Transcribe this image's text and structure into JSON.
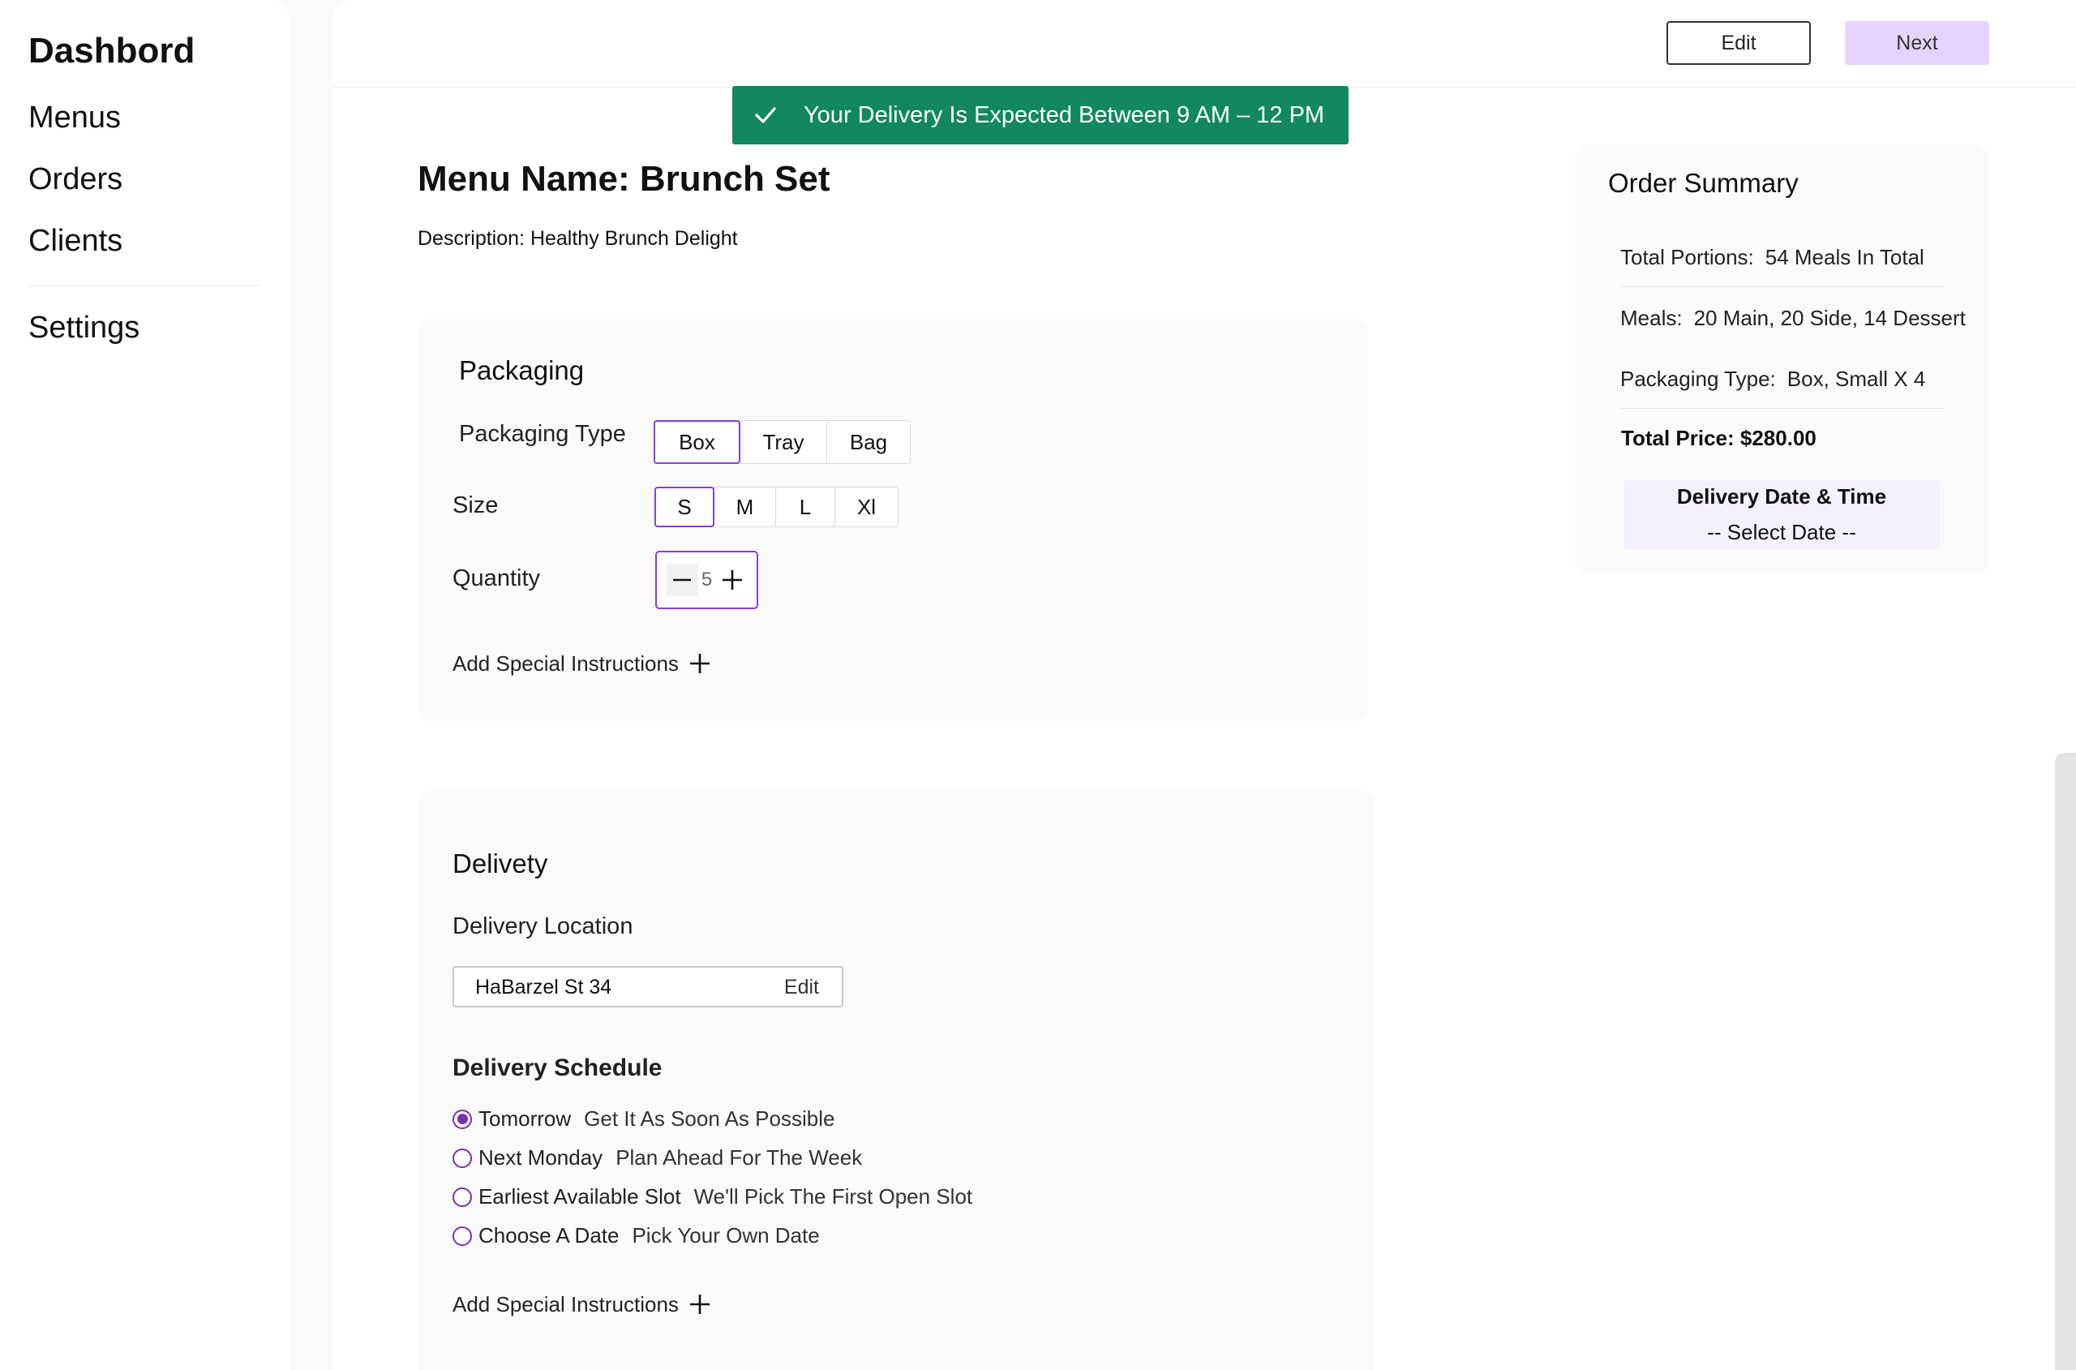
{
  "sidebar": {
    "title": "Dashbord",
    "items": [
      {
        "label": "Menus"
      },
      {
        "label": "Orders"
      },
      {
        "label": "Clients"
      },
      {
        "label": "Settings"
      }
    ]
  },
  "toolbar": {
    "edit_label": "Edit",
    "next_label": "Next"
  },
  "toast": {
    "message": "Your Delivery Is Expected Between 9 AM – 12 PM",
    "icon": "check-icon",
    "color": "#12885f"
  },
  "menu": {
    "name": "Menu  Name: Brunch Set",
    "description": "Description: Healthy Brunch Delight"
  },
  "packaging": {
    "heading": "Packaging",
    "type_label": "Packaging Type",
    "types": [
      "Box",
      "Tray",
      "Bag"
    ],
    "selected_type": "Box",
    "size_label": "Size",
    "sizes": [
      "S",
      "M",
      "L",
      "Xl"
    ],
    "selected_size": "S",
    "quantity_label": "Quantity",
    "quantity": "5",
    "add_instructions": "Add Special Instructions"
  },
  "delivery": {
    "heading": "Delivety",
    "location_label": "Delivery Location",
    "address": "HaBarzel St 34",
    "address_edit": "Edit",
    "schedule_label": "Delivery Schedule",
    "options": [
      {
        "label": "Tomorrow",
        "sub": "Get It As Soon As Possible",
        "checked": true
      },
      {
        "label": "Next Monday",
        "sub": "Plan Ahead For The Week",
        "checked": false
      },
      {
        "label": "Earliest Available Slot",
        "sub": "We'll Pick The First Open Slot",
        "checked": false
      },
      {
        "label": "Choose A Date",
        "sub": "Pick Your Own Date",
        "checked": false
      }
    ],
    "add_instructions": "Add Special Instructions"
  },
  "summary": {
    "title": "Order Summary",
    "portions_key": "Total Portions:",
    "portions_val": "54 Meals In Total",
    "meals_key": "Meals:",
    "meals_val": "20 Main, 20 Side, 14 Dessert",
    "packaging_key": "Packaging Type:",
    "packaging_val": "Box, Small X 4",
    "total_price": "Total Price: $280.00",
    "delivery_title": "Delivery Date & Time",
    "delivery_select": "-- Select Date --"
  },
  "colors": {
    "accent": "#8a3fd6",
    "radio": "#7a2fb8",
    "next_button": "#e4d4fb"
  }
}
